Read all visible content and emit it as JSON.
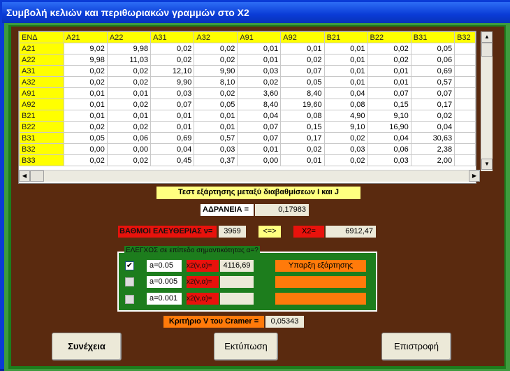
{
  "window": {
    "title": "Συμβολή κελιών και περιθωριακών γραμμών στο Χ2"
  },
  "grid": {
    "corner": "ΕΝΔ",
    "columns": [
      "A21",
      "A22",
      "A31",
      "A32",
      "A91",
      "A92",
      "B21",
      "B22",
      "B31",
      "B32"
    ],
    "rows": [
      {
        "label": "A21",
        "values": [
          "9,02",
          "9,98",
          "0,02",
          "0,02",
          "0,01",
          "0,01",
          "0,01",
          "0,02",
          "0,05"
        ]
      },
      {
        "label": "A22",
        "values": [
          "9,98",
          "11,03",
          "0,02",
          "0,02",
          "0,01",
          "0,02",
          "0,01",
          "0,02",
          "0,06"
        ]
      },
      {
        "label": "A31",
        "values": [
          "0,02",
          "0,02",
          "12,10",
          "9,90",
          "0,03",
          "0,07",
          "0,01",
          "0,01",
          "0,69"
        ]
      },
      {
        "label": "A32",
        "values": [
          "0,02",
          "0,02",
          "9,90",
          "8,10",
          "0,02",
          "0,05",
          "0,01",
          "0,01",
          "0,57"
        ]
      },
      {
        "label": "A91",
        "values": [
          "0,01",
          "0,01",
          "0,03",
          "0,02",
          "3,60",
          "8,40",
          "0,04",
          "0,07",
          "0,07"
        ]
      },
      {
        "label": "A92",
        "values": [
          "0,01",
          "0,02",
          "0,07",
          "0,05",
          "8,40",
          "19,60",
          "0,08",
          "0,15",
          "0,17"
        ]
      },
      {
        "label": "B21",
        "values": [
          "0,01",
          "0,01",
          "0,01",
          "0,01",
          "0,04",
          "0,08",
          "4,90",
          "9,10",
          "0,02"
        ]
      },
      {
        "label": "B22",
        "values": [
          "0,02",
          "0,02",
          "0,01",
          "0,01",
          "0,07",
          "0,15",
          "9,10",
          "16,90",
          "0,04"
        ]
      },
      {
        "label": "B31",
        "values": [
          "0,05",
          "0,06",
          "0,69",
          "0,57",
          "0,07",
          "0,17",
          "0,02",
          "0,04",
          "30,63"
        ]
      },
      {
        "label": "B32",
        "values": [
          "0,00",
          "0,00",
          "0,04",
          "0,03",
          "0,01",
          "0,02",
          "0,03",
          "0,06",
          "2,38"
        ]
      },
      {
        "label": "B33",
        "values": [
          "0,02",
          "0,02",
          "0,45",
          "0,37",
          "0,00",
          "0,01",
          "0,02",
          "0,03",
          "2,00"
        ]
      }
    ]
  },
  "test_title": "Τεστ εξάρτησης μεταξύ διαβαθμίσεων I και J",
  "inertia": {
    "label": "ΑΔΡΑΝΕΙΑ =",
    "value": "0,17983"
  },
  "dof": {
    "label": "ΒΑΘΜΟΙ ΕΛΕΥΘΕΡΙΑΣ  ν=",
    "value": "3969"
  },
  "arrow": "<=>",
  "x2": {
    "label": "X2=",
    "value": "6912,47"
  },
  "tests": {
    "legend": "ΕΛΕΓΧΟΣ σε επίπεδο σημαντικότητας α=?",
    "rows": [
      {
        "checked": true,
        "alpha": "a=0.05",
        "crit_label": "x2(ν,α)=",
        "crit_value": "4116,69",
        "result": "Υπαρξη εξάρτησης"
      },
      {
        "checked": false,
        "alpha": "a=0.005",
        "crit_label": "x2(ν,α)=",
        "crit_value": "",
        "result": ""
      },
      {
        "checked": false,
        "alpha": "a=0.001",
        "crit_label": "x2(ν,α)=",
        "crit_value": "",
        "result": ""
      }
    ]
  },
  "cramer": {
    "label": "Κριτήριο V του Cramer =",
    "value": "0,05343"
  },
  "buttons": {
    "continue": "Συνέχεια",
    "print": "Εκτύπωση",
    "back": "Επιστροφή"
  },
  "colors": {
    "header_yellow": "#ffff00",
    "panel_brown": "#5a2a0f",
    "frame_green": "#1d7d1d",
    "label_red": "#e8120c",
    "result_orange": "#ff7a0a",
    "title_yellow": "#ffff80"
  }
}
